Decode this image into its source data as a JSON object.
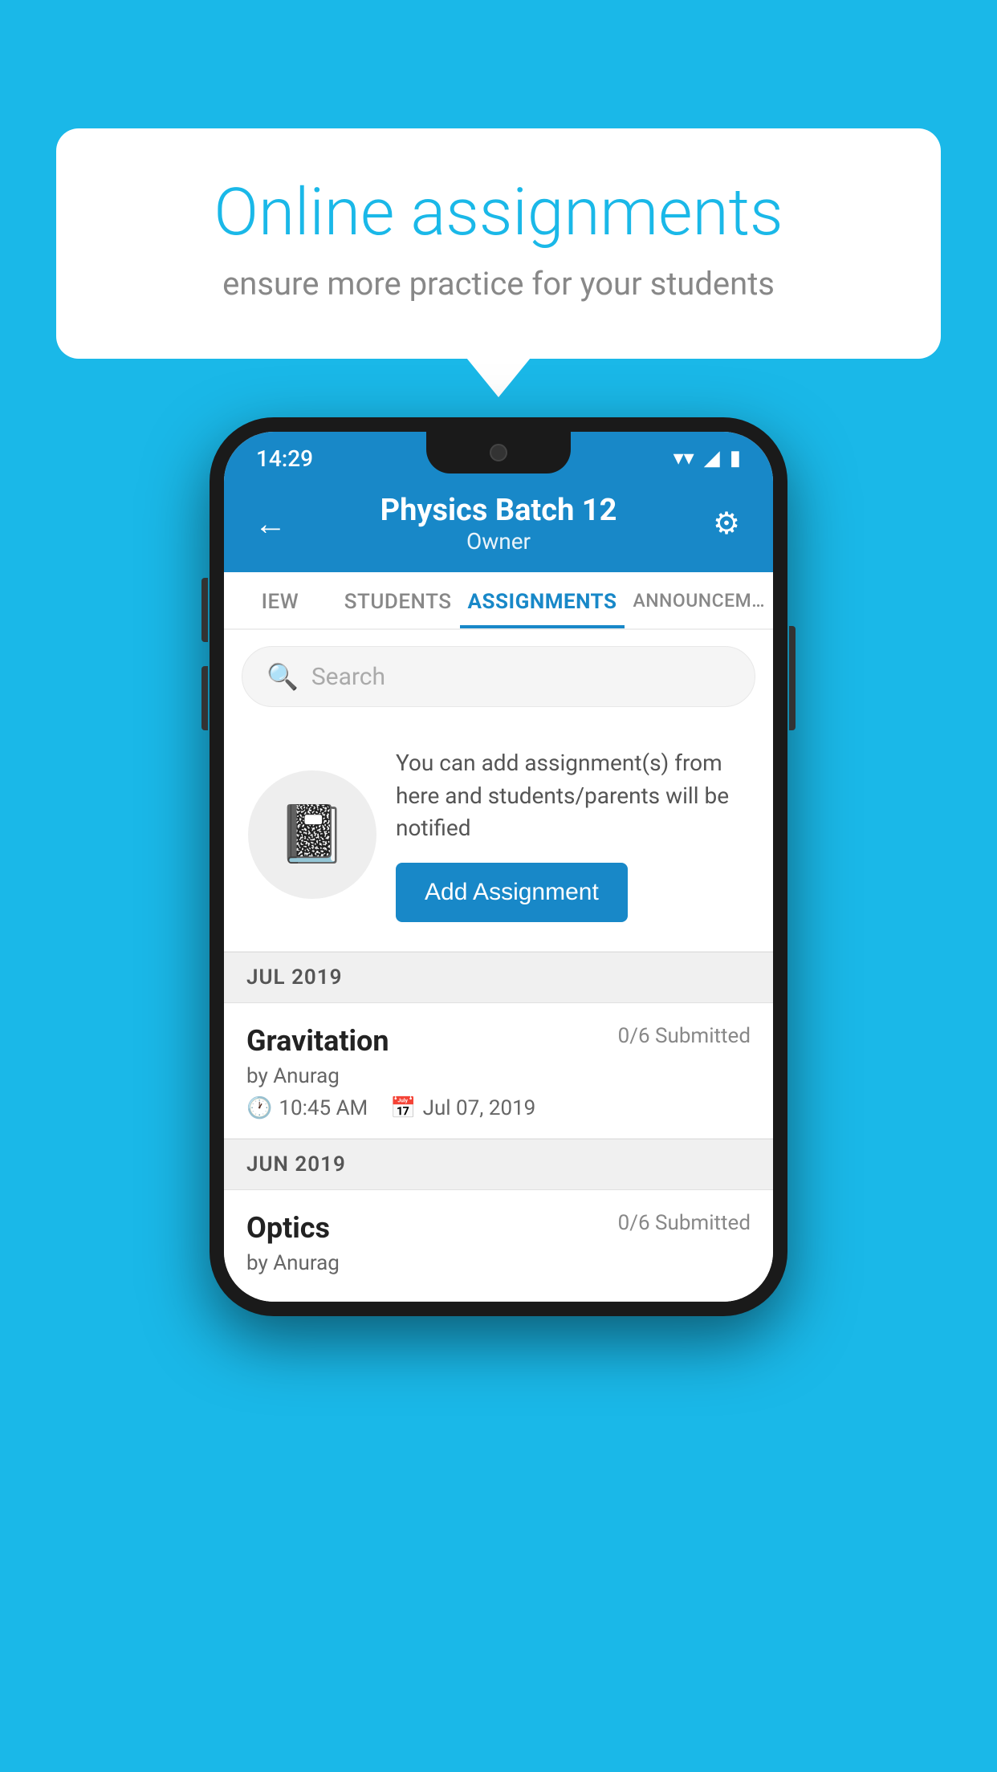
{
  "background_color": "#1ab8e8",
  "bubble": {
    "title": "Online assignments",
    "subtitle": "ensure more practice for your students"
  },
  "status_bar": {
    "time": "14:29",
    "wifi": "▼",
    "signal": "◢",
    "battery": "▮"
  },
  "header": {
    "title": "Physics Batch 12",
    "subtitle": "Owner",
    "back_label": "←",
    "settings_label": "⚙"
  },
  "tabs": [
    {
      "label": "IEW",
      "active": false
    },
    {
      "label": "STUDENTS",
      "active": false
    },
    {
      "label": "ASSIGNMENTS",
      "active": true
    },
    {
      "label": "ANNOUNCEM…",
      "active": false
    }
  ],
  "search": {
    "placeholder": "Search"
  },
  "promo": {
    "description": "You can add assignment(s) from here and students/parents will be notified",
    "button_label": "Add Assignment"
  },
  "sections": [
    {
      "header": "JUL 2019",
      "assignments": [
        {
          "title": "Gravitation",
          "submitted": "0/6 Submitted",
          "by": "by Anurag",
          "time": "10:45 AM",
          "date": "Jul 07, 2019"
        }
      ]
    },
    {
      "header": "JUN 2019",
      "assignments": [
        {
          "title": "Optics",
          "submitted": "0/6 Submitted",
          "by": "by Anurag",
          "time": "",
          "date": ""
        }
      ]
    }
  ]
}
